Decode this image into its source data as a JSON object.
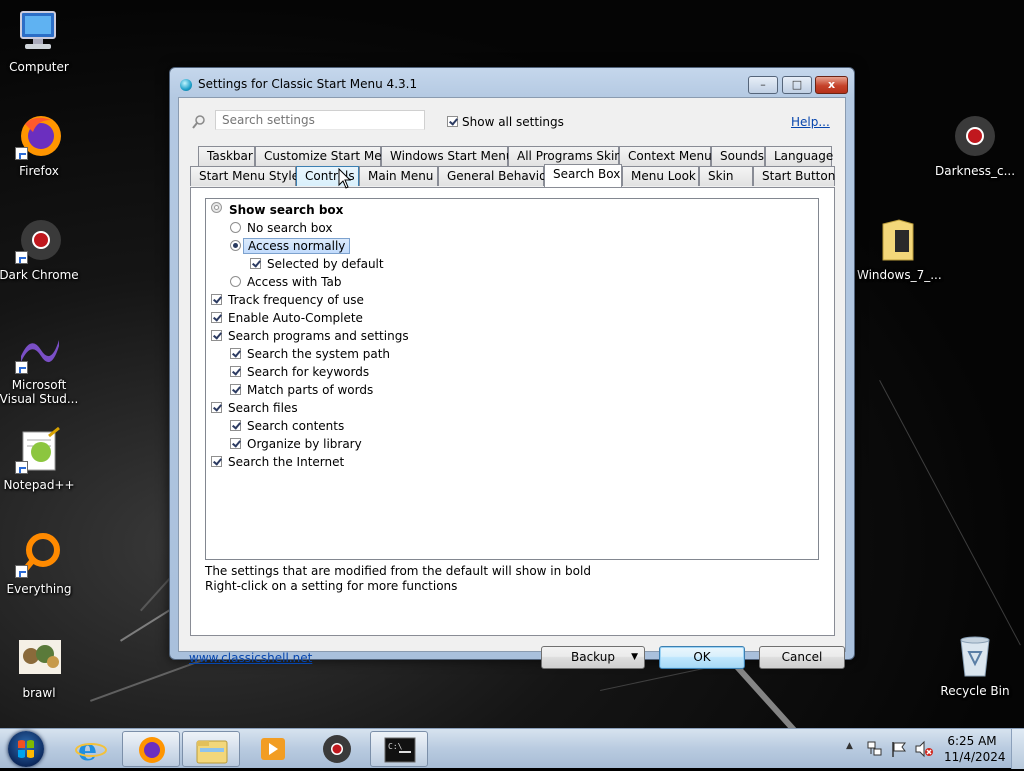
{
  "desktop": {
    "icons": [
      {
        "label": "Computer",
        "icon": "computer-icon"
      },
      {
        "label": "Firefox",
        "icon": "firefox-icon"
      },
      {
        "label": "Dark Chrome",
        "icon": "chrome-icon"
      },
      {
        "label": "Microsoft Visual Stud...",
        "icon": "visual-studio-icon"
      },
      {
        "label": "Notepad++",
        "icon": "notepadpp-icon"
      },
      {
        "label": "Everything",
        "icon": "everything-icon"
      },
      {
        "label": "brawl",
        "icon": "image-file-icon"
      },
      {
        "label": "Darkness_c...",
        "icon": "chrome-icon"
      },
      {
        "label": "Windows_7_...",
        "icon": "folder-icon"
      },
      {
        "label": "Recycle Bin",
        "icon": "recycle-bin-icon"
      }
    ]
  },
  "window": {
    "title": "Settings for Classic Start Menu 4.3.1",
    "buttons": {
      "minimize": "–",
      "maximize": "□",
      "close": "x"
    },
    "search": {
      "placeholder": "Search settings",
      "value": ""
    },
    "show_all_label": "Show all settings",
    "show_all_checked": true,
    "help_label": "Help...",
    "tabs_row1": [
      "Taskbar",
      "Customize Start Menu",
      "Windows Start Menu",
      "All Programs Skin",
      "Context Menu",
      "Sounds",
      "Language"
    ],
    "tabs_row2": [
      "Start Menu Style",
      "Controls",
      "Main Menu",
      "General Behavior",
      "Search Box",
      "Menu Look",
      "Skin",
      "Start Button"
    ],
    "selected_tab": "Search Box",
    "hovered_tab": "Controls",
    "settings": [
      {
        "label": "Show search box",
        "kind": "group",
        "bold": true
      },
      {
        "label": "No search box",
        "kind": "radio",
        "checked": false
      },
      {
        "label": "Access normally",
        "kind": "radio",
        "checked": true,
        "selected": true
      },
      {
        "label": "Selected by default",
        "kind": "check",
        "checked": true
      },
      {
        "label": "Access with Tab",
        "kind": "radio",
        "checked": false
      },
      {
        "label": "Track frequency of use",
        "kind": "check",
        "checked": true
      },
      {
        "label": "Enable Auto-Complete",
        "kind": "check",
        "checked": true
      },
      {
        "label": "Search programs and settings",
        "kind": "check",
        "checked": true
      },
      {
        "label": "Search the system path",
        "kind": "check",
        "checked": true
      },
      {
        "label": "Search for keywords",
        "kind": "check",
        "checked": true
      },
      {
        "label": "Match parts of words",
        "kind": "check",
        "checked": true
      },
      {
        "label": "Search files",
        "kind": "check",
        "checked": true
      },
      {
        "label": "Search contents",
        "kind": "check",
        "checked": true
      },
      {
        "label": "Organize by library",
        "kind": "check",
        "checked": true
      },
      {
        "label": "Search the Internet",
        "kind": "check",
        "checked": true
      }
    ],
    "hint_line1": "The settings that are modified from the default will show in bold",
    "hint_line2": "Right-click on a setting for more functions",
    "site_link": "www.classicshell.net",
    "backup_label": "Backup",
    "ok_label": "OK",
    "cancel_label": "Cancel"
  },
  "taskbar": {
    "items": [
      "internet-explorer-icon",
      "firefox-icon",
      "file-explorer-icon",
      "media-player-icon",
      "chrome-icon",
      "command-prompt-icon"
    ],
    "clock_time": "6:25 AM",
    "clock_date": "11/4/2024"
  }
}
